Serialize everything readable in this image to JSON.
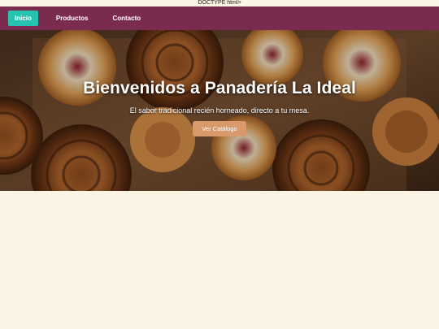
{
  "stray_text": "DOCTYPE html>",
  "nav": {
    "items": [
      {
        "label": "Inicio",
        "active": true
      },
      {
        "label": "Productos",
        "active": false
      },
      {
        "label": "Contacto",
        "active": false
      }
    ]
  },
  "hero": {
    "title": "Bienvenidos a Panadería La Ideal",
    "subtitle": "El sabor tradicional recién horneado, directo a tu mesa.",
    "button_label": "Ver Catálogo"
  },
  "colors": {
    "navbar": "#7a2b4f",
    "active_tab": "#26c3b0",
    "button": "#d89a6b",
    "page_background": "#fbf3e3"
  }
}
